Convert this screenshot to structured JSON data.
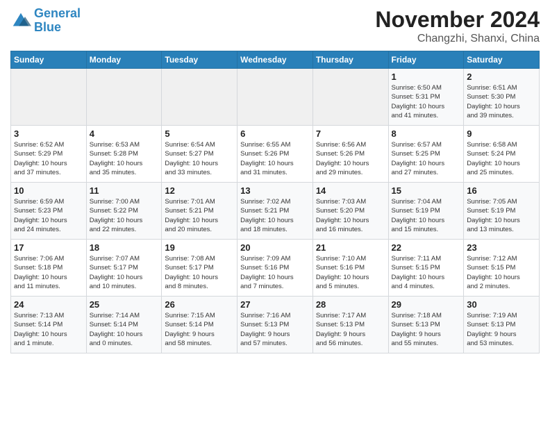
{
  "logo": {
    "line1": "General",
    "line2": "Blue"
  },
  "title": "November 2024",
  "location": "Changzhi, Shanxi, China",
  "days_header": [
    "Sunday",
    "Monday",
    "Tuesday",
    "Wednesday",
    "Thursday",
    "Friday",
    "Saturday"
  ],
  "weeks": [
    [
      {
        "day": "",
        "info": ""
      },
      {
        "day": "",
        "info": ""
      },
      {
        "day": "",
        "info": ""
      },
      {
        "day": "",
        "info": ""
      },
      {
        "day": "",
        "info": ""
      },
      {
        "day": "1",
        "info": "Sunrise: 6:50 AM\nSunset: 5:31 PM\nDaylight: 10 hours\nand 41 minutes."
      },
      {
        "day": "2",
        "info": "Sunrise: 6:51 AM\nSunset: 5:30 PM\nDaylight: 10 hours\nand 39 minutes."
      }
    ],
    [
      {
        "day": "3",
        "info": "Sunrise: 6:52 AM\nSunset: 5:29 PM\nDaylight: 10 hours\nand 37 minutes."
      },
      {
        "day": "4",
        "info": "Sunrise: 6:53 AM\nSunset: 5:28 PM\nDaylight: 10 hours\nand 35 minutes."
      },
      {
        "day": "5",
        "info": "Sunrise: 6:54 AM\nSunset: 5:27 PM\nDaylight: 10 hours\nand 33 minutes."
      },
      {
        "day": "6",
        "info": "Sunrise: 6:55 AM\nSunset: 5:26 PM\nDaylight: 10 hours\nand 31 minutes."
      },
      {
        "day": "7",
        "info": "Sunrise: 6:56 AM\nSunset: 5:26 PM\nDaylight: 10 hours\nand 29 minutes."
      },
      {
        "day": "8",
        "info": "Sunrise: 6:57 AM\nSunset: 5:25 PM\nDaylight: 10 hours\nand 27 minutes."
      },
      {
        "day": "9",
        "info": "Sunrise: 6:58 AM\nSunset: 5:24 PM\nDaylight: 10 hours\nand 25 minutes."
      }
    ],
    [
      {
        "day": "10",
        "info": "Sunrise: 6:59 AM\nSunset: 5:23 PM\nDaylight: 10 hours\nand 24 minutes."
      },
      {
        "day": "11",
        "info": "Sunrise: 7:00 AM\nSunset: 5:22 PM\nDaylight: 10 hours\nand 22 minutes."
      },
      {
        "day": "12",
        "info": "Sunrise: 7:01 AM\nSunset: 5:21 PM\nDaylight: 10 hours\nand 20 minutes."
      },
      {
        "day": "13",
        "info": "Sunrise: 7:02 AM\nSunset: 5:21 PM\nDaylight: 10 hours\nand 18 minutes."
      },
      {
        "day": "14",
        "info": "Sunrise: 7:03 AM\nSunset: 5:20 PM\nDaylight: 10 hours\nand 16 minutes."
      },
      {
        "day": "15",
        "info": "Sunrise: 7:04 AM\nSunset: 5:19 PM\nDaylight: 10 hours\nand 15 minutes."
      },
      {
        "day": "16",
        "info": "Sunrise: 7:05 AM\nSunset: 5:19 PM\nDaylight: 10 hours\nand 13 minutes."
      }
    ],
    [
      {
        "day": "17",
        "info": "Sunrise: 7:06 AM\nSunset: 5:18 PM\nDaylight: 10 hours\nand 11 minutes."
      },
      {
        "day": "18",
        "info": "Sunrise: 7:07 AM\nSunset: 5:17 PM\nDaylight: 10 hours\nand 10 minutes."
      },
      {
        "day": "19",
        "info": "Sunrise: 7:08 AM\nSunset: 5:17 PM\nDaylight: 10 hours\nand 8 minutes."
      },
      {
        "day": "20",
        "info": "Sunrise: 7:09 AM\nSunset: 5:16 PM\nDaylight: 10 hours\nand 7 minutes."
      },
      {
        "day": "21",
        "info": "Sunrise: 7:10 AM\nSunset: 5:16 PM\nDaylight: 10 hours\nand 5 minutes."
      },
      {
        "day": "22",
        "info": "Sunrise: 7:11 AM\nSunset: 5:15 PM\nDaylight: 10 hours\nand 4 minutes."
      },
      {
        "day": "23",
        "info": "Sunrise: 7:12 AM\nSunset: 5:15 PM\nDaylight: 10 hours\nand 2 minutes."
      }
    ],
    [
      {
        "day": "24",
        "info": "Sunrise: 7:13 AM\nSunset: 5:14 PM\nDaylight: 10 hours\nand 1 minute."
      },
      {
        "day": "25",
        "info": "Sunrise: 7:14 AM\nSunset: 5:14 PM\nDaylight: 10 hours\nand 0 minutes."
      },
      {
        "day": "26",
        "info": "Sunrise: 7:15 AM\nSunset: 5:14 PM\nDaylight: 9 hours\nand 58 minutes."
      },
      {
        "day": "27",
        "info": "Sunrise: 7:16 AM\nSunset: 5:13 PM\nDaylight: 9 hours\nand 57 minutes."
      },
      {
        "day": "28",
        "info": "Sunrise: 7:17 AM\nSunset: 5:13 PM\nDaylight: 9 hours\nand 56 minutes."
      },
      {
        "day": "29",
        "info": "Sunrise: 7:18 AM\nSunset: 5:13 PM\nDaylight: 9 hours\nand 55 minutes."
      },
      {
        "day": "30",
        "info": "Sunrise: 7:19 AM\nSunset: 5:13 PM\nDaylight: 9 hours\nand 53 minutes."
      }
    ]
  ]
}
